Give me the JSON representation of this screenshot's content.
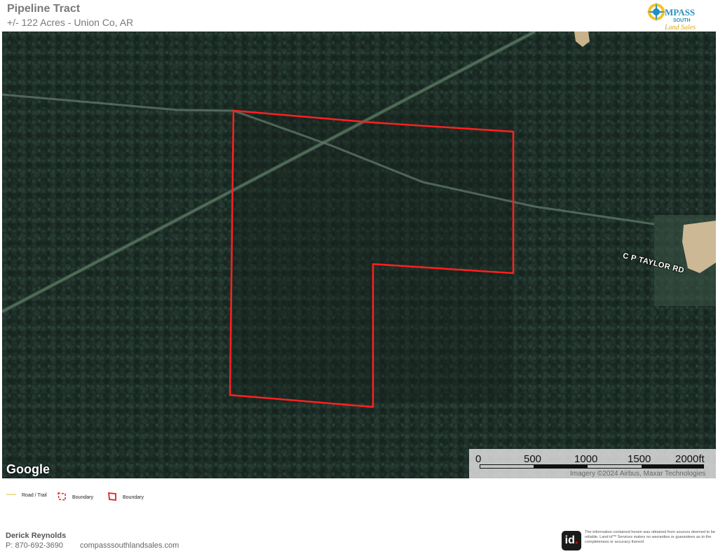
{
  "header": {
    "title": "Pipeline Tract",
    "subtitle": "+/- 122 Acres - Union Co, AR"
  },
  "logo": {
    "text_compass": "COMPASS",
    "text_south": "SOUTH",
    "text_land_sales": "Land Sales"
  },
  "map": {
    "road_label": "C P TAYLOR RD",
    "provider": "Google",
    "imagery_credit": "Imagery ©2024 Airbus, Maxar Technologies",
    "scale_labels": [
      "0",
      "500",
      "1000",
      "1500",
      "2000ft"
    ],
    "boundary_color": "#ff2020"
  },
  "legend": [
    {
      "label": "Road / Trail",
      "color": "#e8d67a",
      "icon": "road-line-icon"
    },
    {
      "label": "Boundary",
      "color": "#e0202a",
      "icon": "boundary-dashed-icon"
    },
    {
      "label": "Boundary",
      "color": "#e0202a",
      "icon": "boundary-solid-icon"
    }
  ],
  "footer": {
    "agent_name": "Derick Reynolds",
    "phone": "P: 870-692-3690",
    "website": "compasssouthlandsales.com",
    "id_logo_text": "id",
    "disclaimer": "The information contained herein was obtained from sources deemed to be reliable. Land id™ Services makes no warranties or guarantees as to the completeness or accuracy thereof."
  }
}
